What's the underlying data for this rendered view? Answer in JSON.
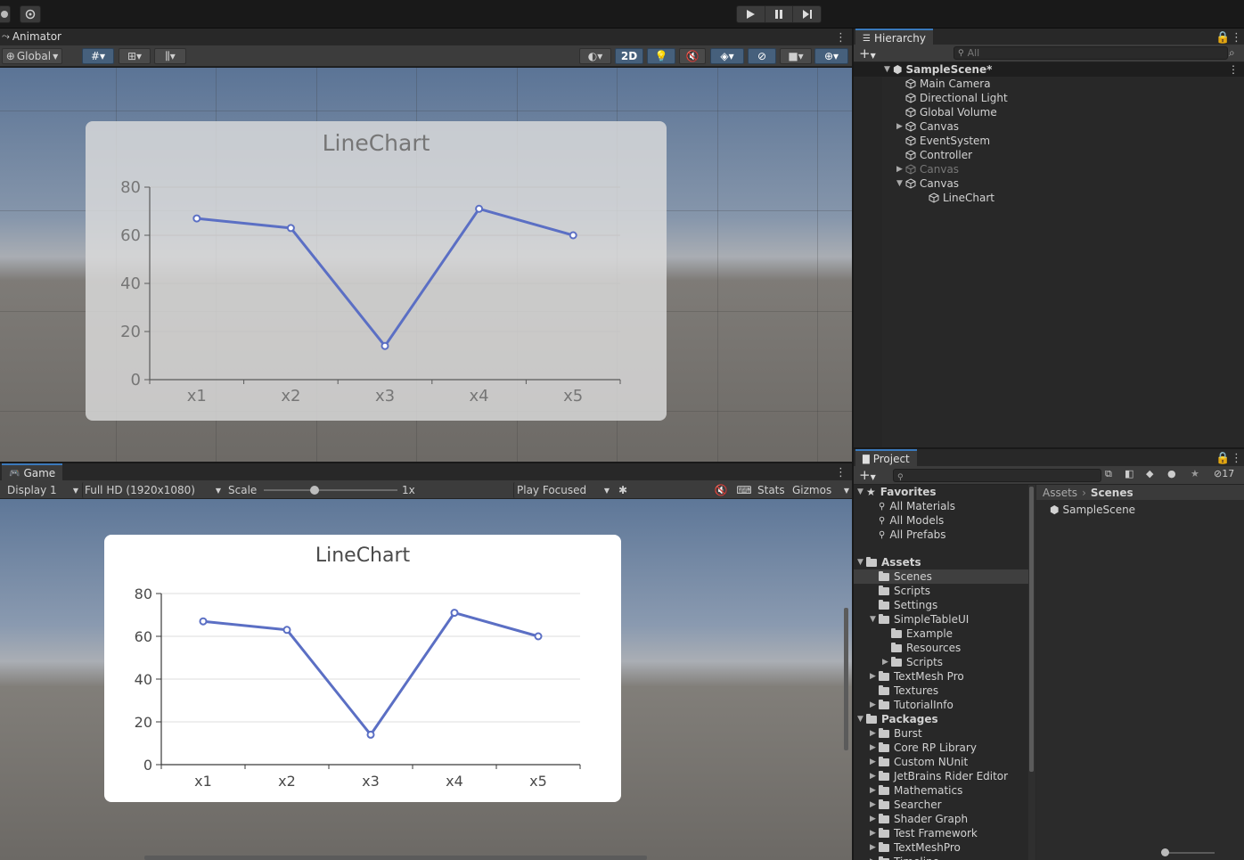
{
  "toolbar": {
    "play_icon": "play-icon",
    "pause_icon": "pause-icon",
    "step_icon": "step-icon"
  },
  "scene_panel": {
    "tab_label": "Animator",
    "global_label": "Global",
    "mode_2d": "2D"
  },
  "game_panel": {
    "tab_label": "Game",
    "display": "Display 1",
    "resolution": "Full HD (1920x1080)",
    "scale_label": "Scale",
    "scale_value": "1x",
    "scale_fraction": 0.38,
    "play_mode": "Play Focused",
    "stats": "Stats",
    "gizmos": "Gizmos"
  },
  "hierarchy": {
    "tab_label": "Hierarchy",
    "search_placeholder": "All",
    "scene": "SampleScene*",
    "items": [
      {
        "label": "Main Camera",
        "depth": 1,
        "arrow": "",
        "dim": false
      },
      {
        "label": "Directional Light",
        "depth": 1,
        "arrow": "",
        "dim": false
      },
      {
        "label": "Global Volume",
        "depth": 1,
        "arrow": "",
        "dim": false
      },
      {
        "label": "Canvas",
        "depth": 1,
        "arrow": "▶",
        "dim": false
      },
      {
        "label": "EventSystem",
        "depth": 1,
        "arrow": "",
        "dim": false
      },
      {
        "label": "Controller",
        "depth": 1,
        "arrow": "",
        "dim": false
      },
      {
        "label": "Canvas",
        "depth": 1,
        "arrow": "▶",
        "dim": true
      },
      {
        "label": "Canvas",
        "depth": 1,
        "arrow": "▼",
        "dim": false
      },
      {
        "label": "LineChart",
        "depth": 2,
        "arrow": "",
        "dim": false
      }
    ]
  },
  "project": {
    "tab_label": "Project",
    "hidden_count": "17",
    "favorites": {
      "label": "Favorites",
      "items": [
        "All Materials",
        "All Models",
        "All Prefabs"
      ]
    },
    "assets": {
      "label": "Assets",
      "items": [
        {
          "label": "Scenes",
          "depth": 1,
          "arrow": "",
          "selected": true
        },
        {
          "label": "Scripts",
          "depth": 1,
          "arrow": "",
          "selected": false
        },
        {
          "label": "Settings",
          "depth": 1,
          "arrow": "",
          "selected": false
        },
        {
          "label": "SimpleTableUI",
          "depth": 1,
          "arrow": "▼",
          "selected": false
        },
        {
          "label": "Example",
          "depth": 2,
          "arrow": "",
          "selected": false
        },
        {
          "label": "Resources",
          "depth": 2,
          "arrow": "",
          "selected": false
        },
        {
          "label": "Scripts",
          "depth": 2,
          "arrow": "▶",
          "selected": false
        },
        {
          "label": "TextMesh Pro",
          "depth": 1,
          "arrow": "▶",
          "selected": false
        },
        {
          "label": "Textures",
          "depth": 1,
          "arrow": "",
          "selected": false
        },
        {
          "label": "TutorialInfo",
          "depth": 1,
          "arrow": "▶",
          "selected": false
        }
      ]
    },
    "packages": {
      "label": "Packages",
      "items": [
        "Burst",
        "Core RP Library",
        "Custom NUnit",
        "JetBrains Rider Editor",
        "Mathematics",
        "Searcher",
        "Shader Graph",
        "Test Framework",
        "TextMeshPro",
        "Timeline"
      ]
    },
    "breadcrumb": [
      "Assets",
      "Scenes"
    ],
    "contents": [
      "SampleScene"
    ]
  },
  "chart_data": [
    {
      "type": "line",
      "title": "LineChart",
      "categories": [
        "x1",
        "x2",
        "x3",
        "x4",
        "x5"
      ],
      "values": [
        67,
        63,
        14,
        71,
        60
      ],
      "ylim": [
        0,
        80
      ],
      "yticks": [
        0,
        20,
        40,
        60,
        80
      ],
      "color": "#5b6fc4",
      "view": "scene"
    },
    {
      "type": "line",
      "title": "LineChart",
      "categories": [
        "x1",
        "x2",
        "x3",
        "x4",
        "x5"
      ],
      "values": [
        67,
        63,
        14,
        71,
        60
      ],
      "ylim": [
        0,
        80
      ],
      "yticks": [
        0,
        20,
        40,
        60,
        80
      ],
      "color": "#5b6fc4",
      "view": "game"
    }
  ]
}
